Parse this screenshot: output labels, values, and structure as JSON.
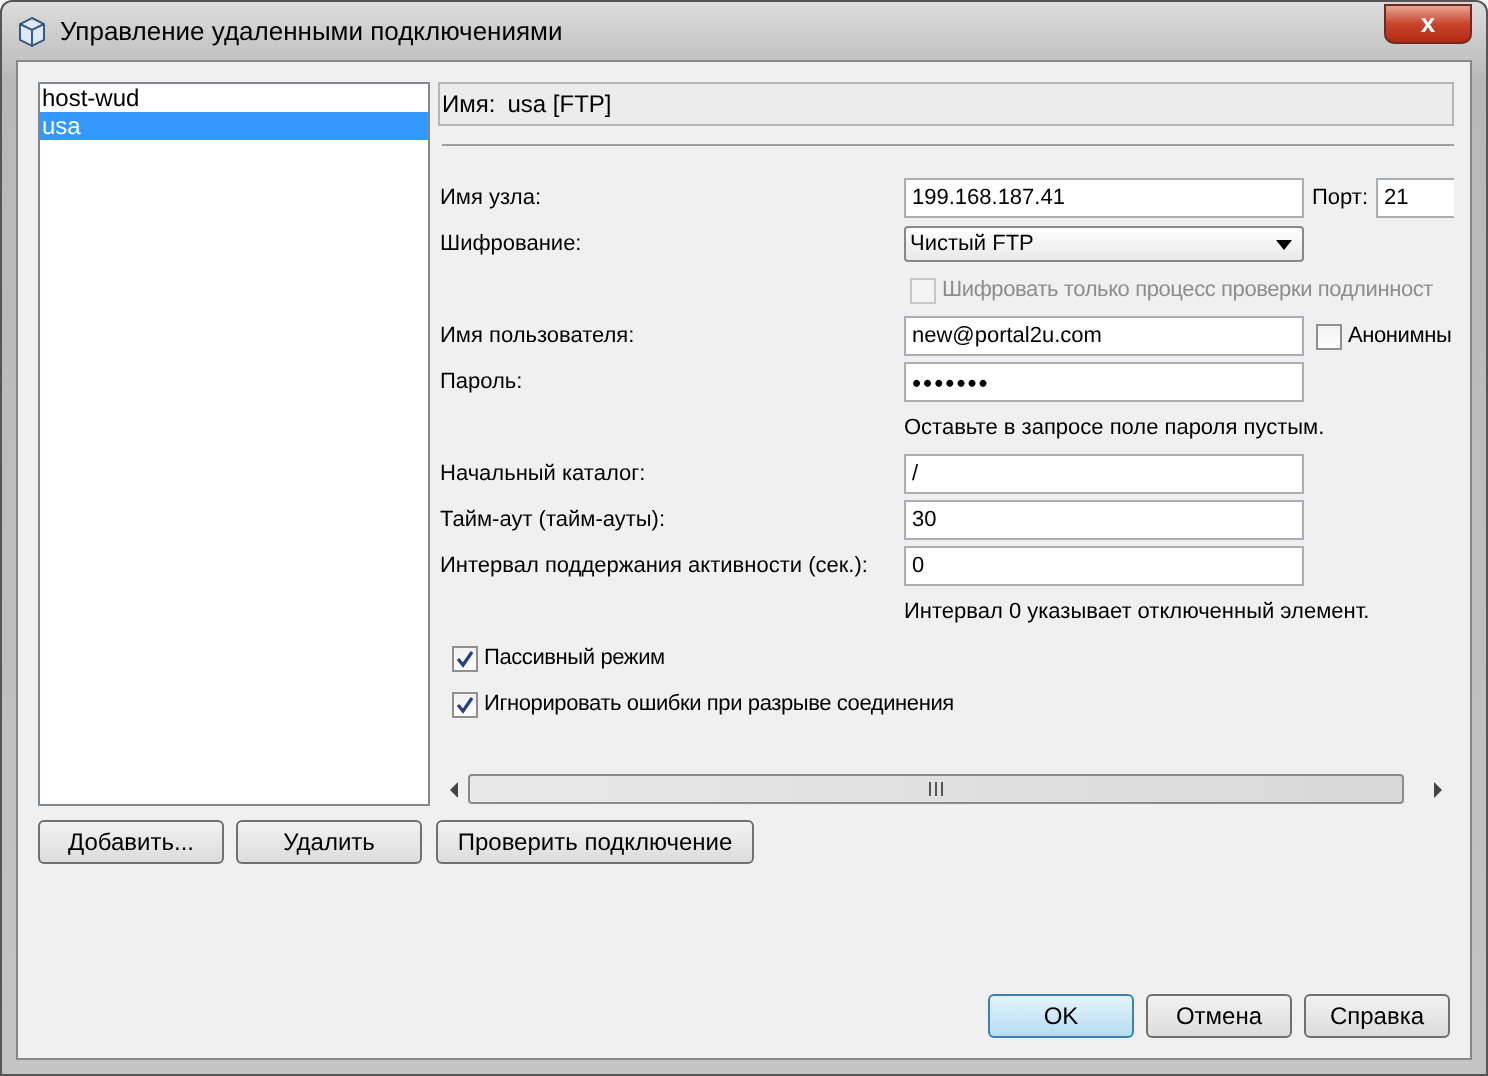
{
  "window": {
    "title": "Управление удаленными подключениями",
    "close": "x"
  },
  "connections": [
    {
      "label": "host-wud",
      "selected": false
    },
    {
      "label": "usa",
      "selected": true
    }
  ],
  "name": {
    "label": "Имя:",
    "value": "usa [FTP]"
  },
  "rows": [
    {
      "kind": "text",
      "label": "Имя узла:",
      "value": "199.168.187.41",
      "extra": {
        "label": "Порт:",
        "value": "21"
      }
    },
    {
      "kind": "select",
      "label": "Шифрование:",
      "value": "Чистый FTP"
    },
    {
      "kind": "check",
      "label": "Шифровать только процесс проверки подлинност",
      "checked": false,
      "disabled": true
    },
    {
      "kind": "text",
      "label": "Имя пользователя:",
      "value": "new@portal2u.com",
      "check": {
        "label": "Анонимны",
        "checked": false
      }
    },
    {
      "kind": "password",
      "label": "Пароль:",
      "value": "•••••••"
    },
    {
      "kind": "hint",
      "label": "Оставьте в запросе поле пароля пустым."
    },
    {
      "kind": "text",
      "label": "Начальный каталог:",
      "value": "/"
    },
    {
      "kind": "text",
      "label": "Тайм-аут (тайм-ауты):",
      "value": "30"
    },
    {
      "kind": "text",
      "label": "Интервал поддержания активности (сек.):",
      "value": "0"
    },
    {
      "kind": "hint",
      "label": "Интервал 0 указывает отключенный элемент."
    },
    {
      "kind": "option",
      "label": "Пассивный режим",
      "checked": true
    },
    {
      "kind": "option",
      "label": "Игнорировать ошибки при разрыве соединения",
      "checked": true
    }
  ],
  "list_buttons": [
    "Добавить...",
    "Удалить",
    "Проверить подключение"
  ],
  "dialog_buttons": [
    {
      "label": "OK",
      "default": true
    },
    {
      "label": "Отмена",
      "default": false
    },
    {
      "label": "Справка",
      "default": false
    }
  ]
}
